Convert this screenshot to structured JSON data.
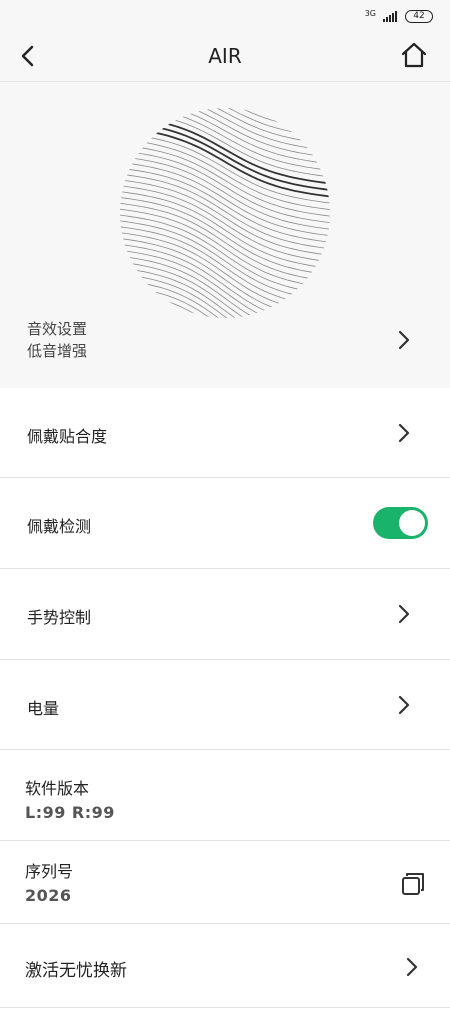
{
  "status_bar": {
    "network": "3G",
    "battery": "42"
  },
  "header": {
    "title": "AIR",
    "back_icon": "chevron-left-icon",
    "home_icon": "home-icon"
  },
  "hero": {
    "line1": "音效设置",
    "line2": "低音增强"
  },
  "rows": {
    "fit": {
      "label": "佩戴贴合度"
    },
    "wear_detect": {
      "label": "佩戴检测",
      "enabled": true,
      "accent": "#19b36b"
    },
    "gesture": {
      "label": "手势控制"
    },
    "battery": {
      "label": "电量"
    },
    "firmware": {
      "label": "软件版本",
      "value": "L:99  R:99"
    },
    "serial": {
      "label": "序列号",
      "value": "2026",
      "icon": "copy-icon"
    },
    "activate": {
      "label": "激活无忧换新"
    }
  }
}
